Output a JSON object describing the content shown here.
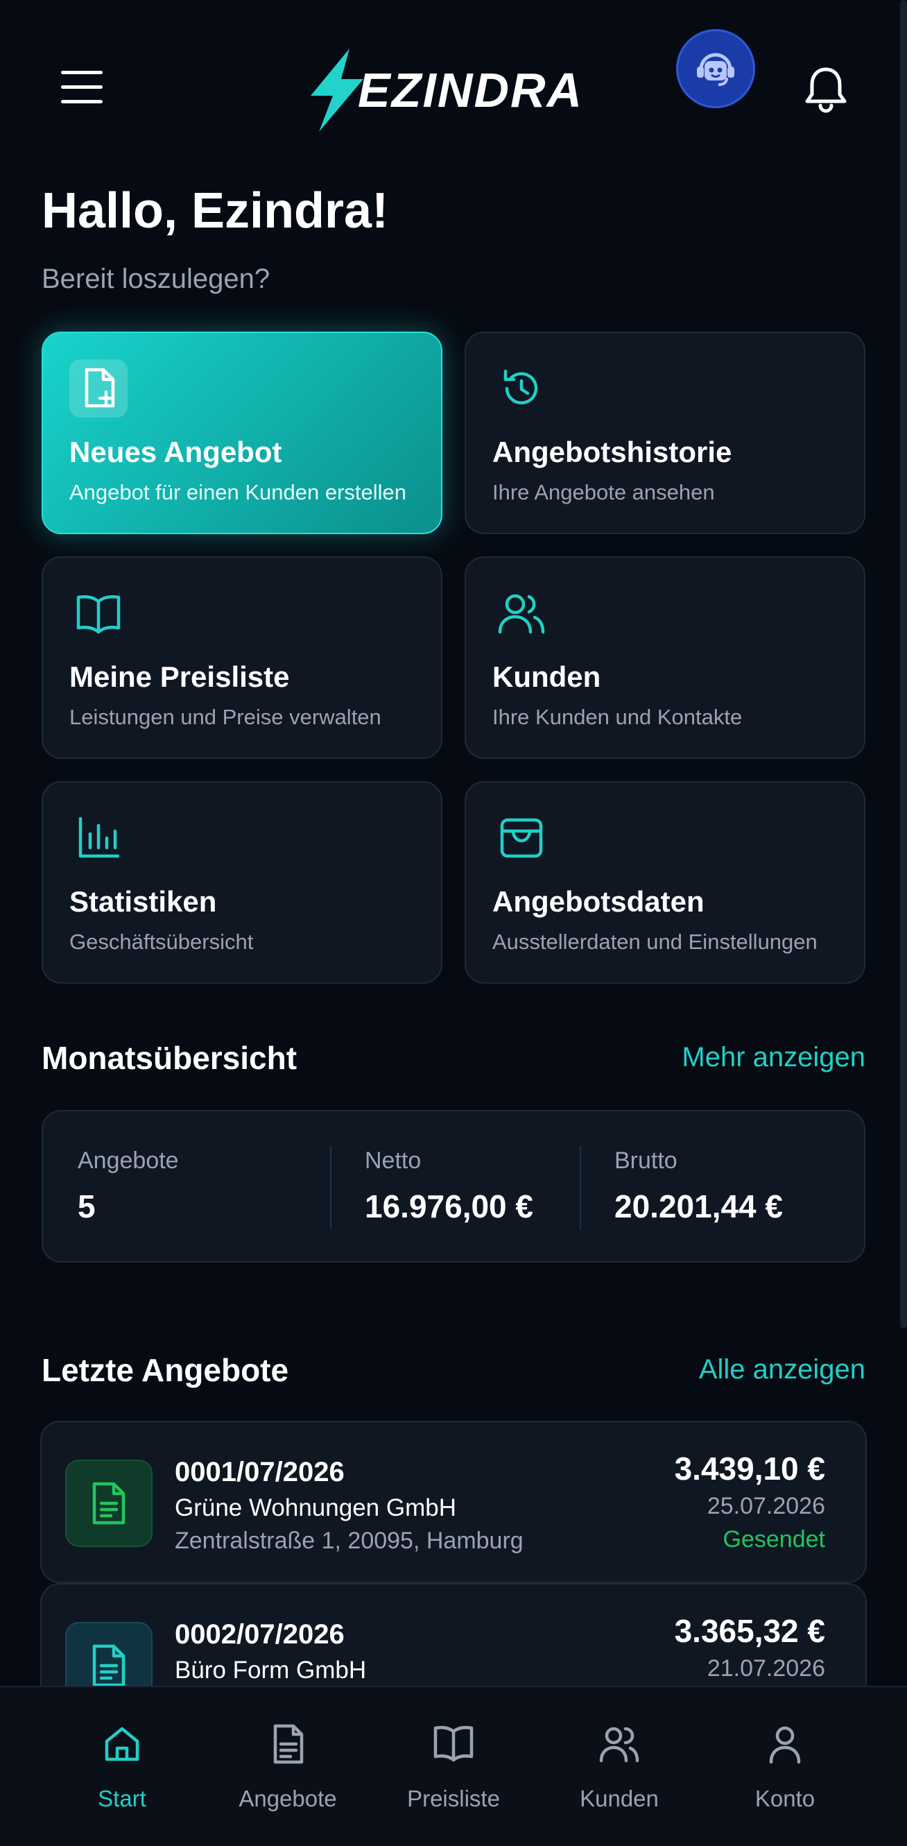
{
  "header": {
    "logo_text": "EZINDRA",
    "menu_icon": "hamburger-menu-icon",
    "support_icon": "robot-support-icon",
    "bell_icon": "bell-icon"
  },
  "greeting": {
    "title": "Hallo, Ezindra!",
    "subtitle": "Bereit loszulegen?"
  },
  "tiles": [
    {
      "title": "Neues Angebot",
      "desc": "Angebot für einen Kunden erstellen",
      "icon": "file-plus-icon"
    },
    {
      "title": "Angebotshistorie",
      "desc": "Ihre Angebote ansehen",
      "icon": "history-icon"
    },
    {
      "title": "Meine Preisliste",
      "desc": "Leistungen und Preise verwalten",
      "icon": "book-open-icon"
    },
    {
      "title": "Kunden",
      "desc": "Ihre Kunden und Kontakte",
      "icon": "users-icon"
    },
    {
      "title": "Statistiken",
      "desc": "Geschäftsübersicht",
      "icon": "bar-chart-icon"
    },
    {
      "title": "Angebotsdaten",
      "desc": "Ausstellerdaten und Einstellungen",
      "icon": "inbox-icon"
    }
  ],
  "month_summary": {
    "title": "Monatsübersicht",
    "link": "Mehr anzeigen",
    "stats": [
      {
        "label": "Angebote",
        "value": "5"
      },
      {
        "label": "Netto",
        "value": "16.976,00 €"
      },
      {
        "label": "Brutto",
        "value": "20.201,44 €"
      }
    ]
  },
  "recent_quotes": {
    "title": "Letzte Angebote",
    "link": "Alle anzeigen",
    "items": [
      {
        "number": "0001/07/2026",
        "customer": "Grüne Wohnungen GmbH",
        "address": "Zentralstraße 1, 20095, Hamburg",
        "amount": "3.439,10 €",
        "date": "25.07.2026",
        "status": "Gesendet"
      },
      {
        "number": "0002/07/2026",
        "customer": "Büro Form GmbH",
        "address": "",
        "amount": "3.365,32 €",
        "date": "21.07.2026",
        "status": ""
      }
    ]
  },
  "bottom_nav": [
    {
      "label": "Start",
      "icon": "home-icon",
      "active": true
    },
    {
      "label": "Angebote",
      "icon": "document-icon",
      "active": false
    },
    {
      "label": "Preisliste",
      "icon": "book-open-icon",
      "active": false
    },
    {
      "label": "Kunden",
      "icon": "users-icon",
      "active": false
    },
    {
      "label": "Konto",
      "icon": "user-icon",
      "active": false
    }
  ],
  "colors": {
    "background": "#060b13",
    "accent": "#22cfc6",
    "card": "#0f1723",
    "status_sent": "#22c55e",
    "support_button": "#1a3ca8"
  }
}
